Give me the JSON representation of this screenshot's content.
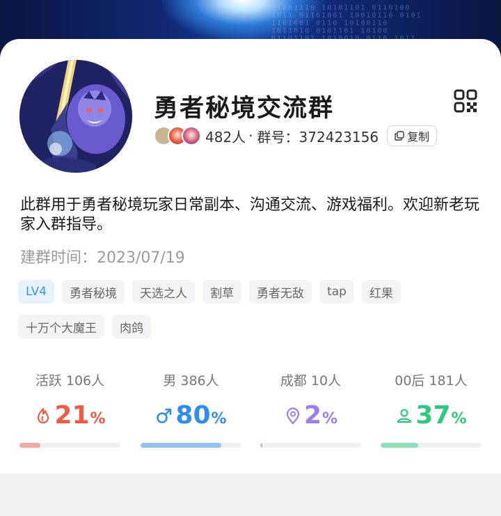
{
  "group": {
    "name": "勇者秘境交流群",
    "member_count_text": "482人",
    "separator": "·",
    "group_id_text": "群号：372423156",
    "copy_label": "复制",
    "description": "此群用于勇者秘境玩家日常副本、沟通交流、游戏福利。欢迎新老玩家入群指导。",
    "created_text": "建群时间：2023/07/19"
  },
  "tags": [
    "LV4",
    "勇者秘境",
    "天选之人",
    "割草",
    "勇者无敌",
    "tap",
    "红果",
    "十万个大魔王",
    "肉鸽"
  ],
  "stats": [
    {
      "label": "活跃 106人",
      "value": "21",
      "unit": "%",
      "fraction": 0.21,
      "color": "#f15a45",
      "bar_color": "#f4a89c",
      "icon": "flame-icon"
    },
    {
      "label": "男 386人",
      "value": "80",
      "unit": "%",
      "fraction": 0.8,
      "color": "#2f8ff0",
      "bar_color": "#93c2f5",
      "icon": "male-icon"
    },
    {
      "label": "成都 10人",
      "value": "2",
      "unit": "%",
      "fraction": 0.02,
      "color": "#9b7ef0",
      "bar_color": "#c3b3f5",
      "icon": "location-pin-icon"
    },
    {
      "label": "00后 181人",
      "value": "37",
      "unit": "%",
      "fraction": 0.37,
      "color": "#2ec97d",
      "bar_color": "#8fdfb6",
      "icon": "person-icon"
    }
  ],
  "colors": {
    "accent": "#3b96e0",
    "text": "#1a1a1a",
    "muted": "#9a9a9a"
  }
}
